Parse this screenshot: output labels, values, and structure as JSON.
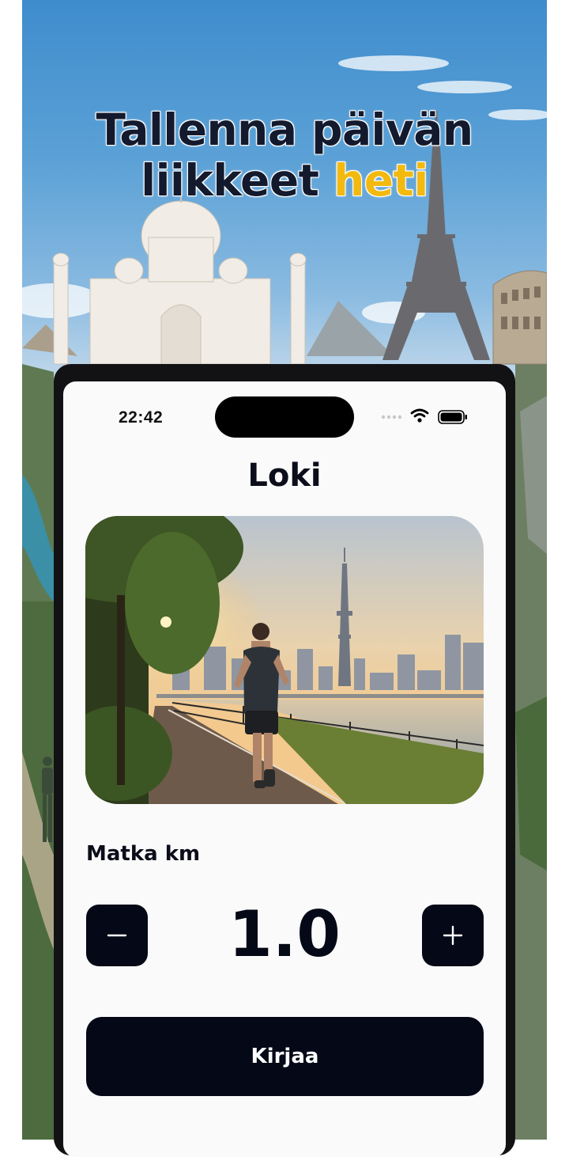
{
  "promo": {
    "headline_line1": "Tallenna päivän",
    "headline_line2_prefix": "liikkeet ",
    "headline_accent": "heti",
    "accent_color": "#f2b90f"
  },
  "status_bar": {
    "time": "22:42"
  },
  "screen": {
    "title": "Loki",
    "photo": "runner-on-riverside-path-at-sunset",
    "distance_label": "Matka km",
    "distance_value": "1.0",
    "decrement_icon": "minus-icon",
    "increment_icon": "plus-icon",
    "submit_label": "Kirjaa"
  },
  "colors": {
    "button_dark": "#050816",
    "screen_bg": "#fafafa",
    "text_dark": "#0b0d1a"
  }
}
